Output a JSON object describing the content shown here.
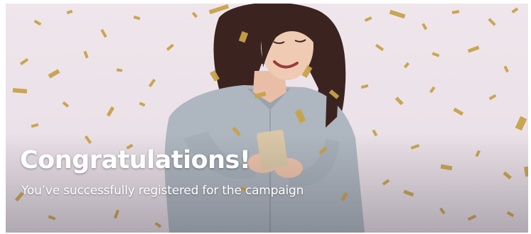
{
  "banner": {
    "title": "Congratulations!",
    "subtitle": "You’ve successfully registered for the campaign",
    "image_alt": "Smiling woman looking at her phone while golden confetti falls"
  },
  "colors": {
    "background": "#ece3ea",
    "confetti": "#c9a24a",
    "text": "#ffffff"
  }
}
